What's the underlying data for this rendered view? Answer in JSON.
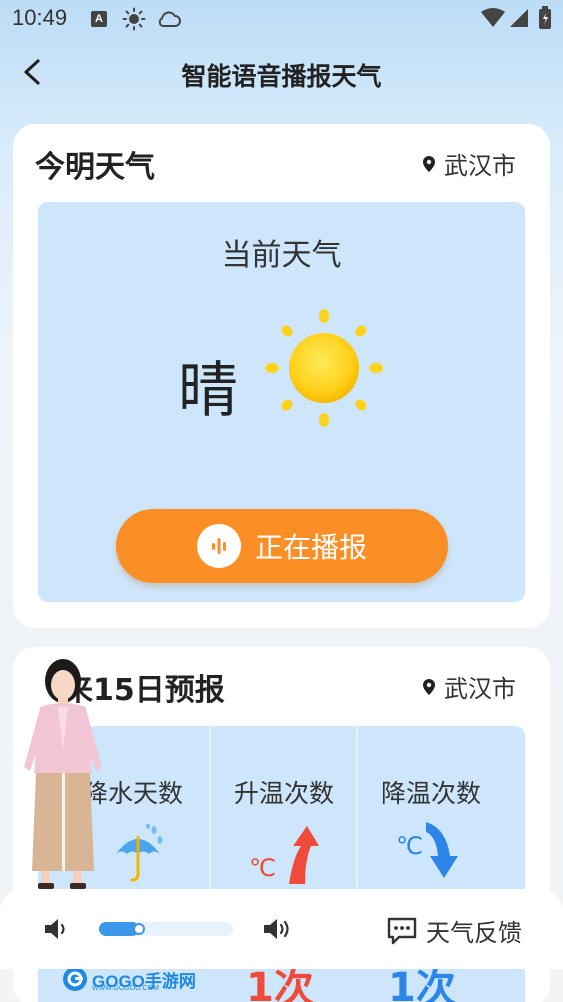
{
  "status_bar": {
    "time": "10:49",
    "badge": "A"
  },
  "nav": {
    "title": "智能语音播报天气",
    "back_icon": "chevron-left-icon"
  },
  "today_card": {
    "title": "今明天气",
    "location": "武汉市",
    "current_label": "当前天气",
    "condition": "晴",
    "condition_icon": "sun-icon",
    "broadcast_button": "正在播报"
  },
  "forecast_card": {
    "title": "未来15日预报",
    "title_visible": "来15日预报",
    "location": "武汉市",
    "columns": [
      {
        "label": "降水天数",
        "label_visible": "降水天数",
        "icon": "umbrella-rain-icon"
      },
      {
        "label": "升温次数",
        "icon": "temperature-up-icon"
      },
      {
        "label": "降温次数",
        "icon": "temperature-down-icon"
      }
    ],
    "partial_values": [
      "1次",
      "1次"
    ]
  },
  "bottom_bar": {
    "volume_level": 0.25,
    "feedback_label": "天气反馈"
  },
  "watermark": {
    "brand": "GOGO手游网",
    "url": "WWW.GOGOO.COM"
  },
  "colors": {
    "accent": "#fb8e25",
    "panel": "#cde6fb",
    "slider": "#3b98ea",
    "up": "#f04a3a",
    "down": "#2b86e8"
  }
}
